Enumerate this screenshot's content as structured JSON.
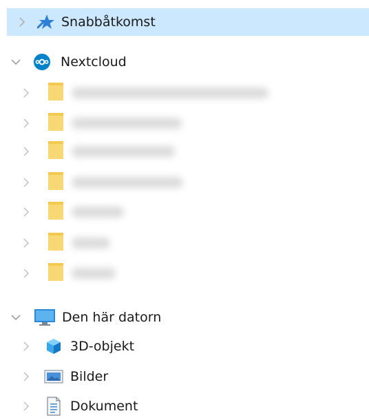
{
  "tree": {
    "quick_access": {
      "label": "Snabbåtkomst",
      "expanded": false,
      "selected": true,
      "icon": "star-icon"
    },
    "nextcloud": {
      "label": "Nextcloud",
      "expanded": true,
      "icon": "nextcloud-icon",
      "folders": [
        {
          "label": "",
          "expanded": false,
          "icon": "folder-icon"
        },
        {
          "label": "",
          "expanded": false,
          "icon": "folder-icon"
        },
        {
          "label": "",
          "expanded": false,
          "icon": "folder-icon"
        },
        {
          "label": "",
          "expanded": false,
          "icon": "folder-icon"
        },
        {
          "label": "",
          "expanded": false,
          "icon": "folder-icon"
        },
        {
          "label": "",
          "expanded": false,
          "icon": "folder-icon"
        },
        {
          "label": "",
          "expanded": false,
          "icon": "folder-icon"
        }
      ]
    },
    "this_pc": {
      "label": "Den här datorn",
      "expanded": true,
      "icon": "computer-icon",
      "children": [
        {
          "label": "3D-objekt",
          "icon": "3d-objects-icon"
        },
        {
          "label": "Bilder",
          "icon": "pictures-icon"
        },
        {
          "label": "Dokument",
          "icon": "documents-icon"
        }
      ]
    }
  },
  "colors": {
    "selection": "#cce8ff",
    "folder": "#f8d775",
    "star": "#2f7fd6",
    "nextcloud": "#0082c9",
    "chevron": "#a0a0a0"
  }
}
